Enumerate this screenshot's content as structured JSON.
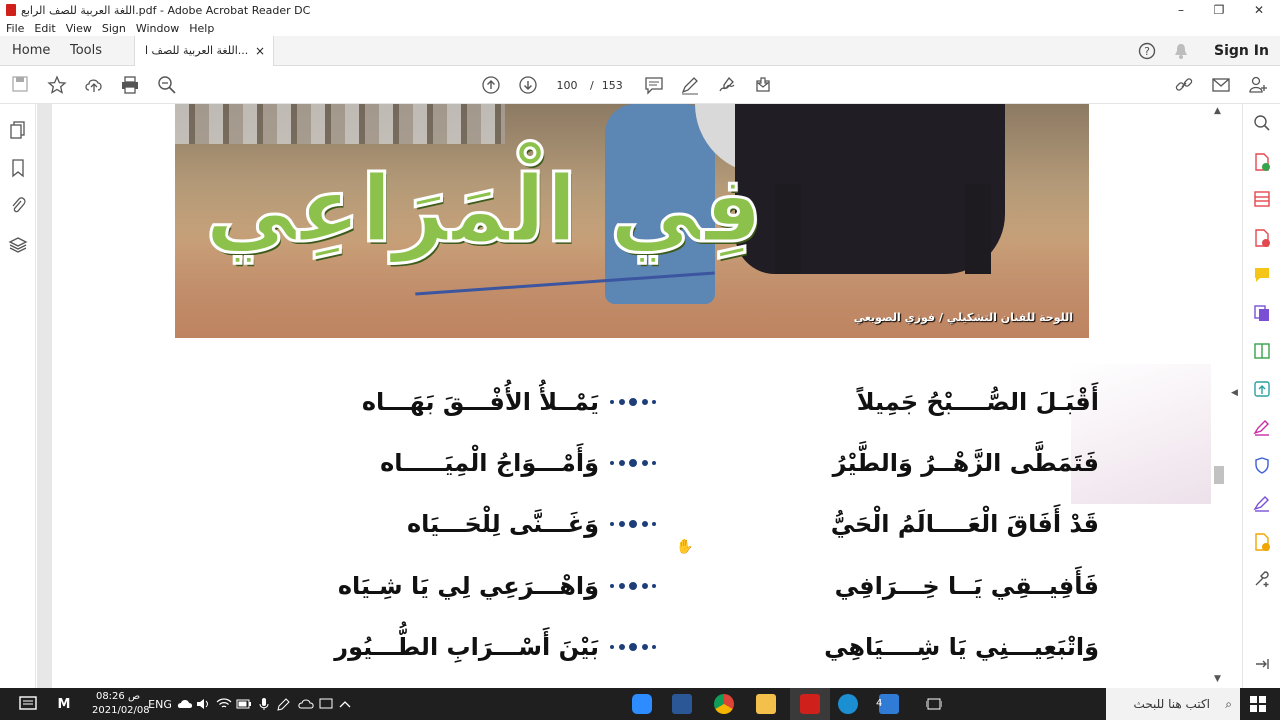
{
  "window": {
    "title": "اللغة العربية للصف الرابع.pdf - Adobe Acrobat Reader DC",
    "controls": {
      "minimize": "–",
      "maximize": "❐",
      "close": "✕"
    }
  },
  "menu": [
    "File",
    "Edit",
    "View",
    "Sign",
    "Window",
    "Help"
  ],
  "tabs": {
    "home": "Home",
    "tools": "Tools",
    "document": "اللغة العربية للصف ا...",
    "close": "×",
    "sign_in": "Sign In"
  },
  "toolbar": {
    "current_page": "100",
    "separator": "/",
    "total_pages": "153"
  },
  "banner": {
    "title": "فِي الْمَرَاعِي",
    "credit": "اللوحة للفنان التشكيلي / فوزي الصويعي"
  },
  "poem": [
    {
      "right": "أَقْبَـلَ الصُّــــبْحُ جَمِيلاً",
      "left": "يَمْــلأُ الأُفْـــقَ بَهَـــاه"
    },
    {
      "right": "فَتَمَطَّى الزَّهْــرُ وَالطَّيْرُ",
      "left": "وَأَمْـــوَاجُ الْمِيَـــــاه"
    },
    {
      "right": "قَدْ أَفَاقَ الْعَــــالَمُ الْحَيُّ",
      "left": "وَغَـــنَّى لِلْحَـــيَاه"
    },
    {
      "right": "فَأَفِيــقِي يَــا خِـــرَافِي",
      "left": "وَاهْـــرَعِي لِي يَا شِـيَاه"
    },
    {
      "right": "وَاتْبَعِيـــنِي يَا شِــــيَاهِي",
      "left": "بَيْنَ أَسْـــرَابِ الطُّـــيُور"
    }
  ],
  "taskbar": {
    "search_placeholder": "اكتب هنا للبحث",
    "time": "08:26 ص",
    "date": "2021/02/08",
    "language": "ENG",
    "mail_badge": "4"
  },
  "colors": {
    "title_green": "#8cc14b",
    "dots_blue": "#1e3e7a",
    "acrobat_red": "#d0201c",
    "taskbar": "#1f1f1f"
  },
  "icons": {
    "toolbar": [
      "save-icon",
      "bookmark-star-icon",
      "upload-icon",
      "print-icon",
      "zoom-icon",
      "page-up-icon",
      "page-down-icon",
      "comment-icon",
      "pen-icon",
      "sign-icon",
      "share-icon",
      "link-icon",
      "mail-icon",
      "add-user-icon"
    ],
    "left_rail": [
      "pages-icon",
      "bookmarks-icon",
      "attachments-icon",
      "layers-icon"
    ],
    "right_rail": [
      "zoom-tool-icon",
      "export-pdf-icon",
      "create-pdf-icon",
      "edit-pdf-icon",
      "comment-tool-icon",
      "combine-icon",
      "organize-icon",
      "compress-icon",
      "fill-sign-icon",
      "protect-icon",
      "sign-tool-icon",
      "scan-icon",
      "more-tools-icon",
      "expand-icon"
    ]
  }
}
